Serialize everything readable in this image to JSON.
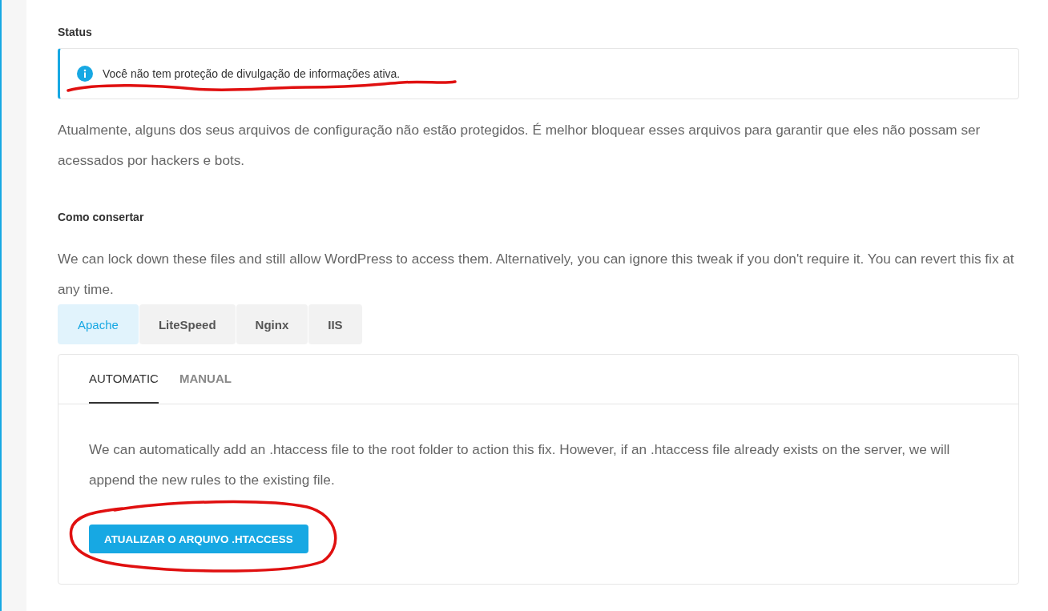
{
  "status": {
    "heading": "Status",
    "notice": "Você não tem proteção de divulgação de informações ativa.",
    "annotation": {
      "kind": "underline"
    }
  },
  "description": "Atualmente, alguns dos seus arquivos de configuração não estão protegidos. É melhor bloquear esses arquivos para garantir que eles não possam ser acessados por hackers e bots.",
  "fix": {
    "heading": "Como consertar",
    "text": "We can lock down these files and still allow WordPress to access them. Alternatively, you can ignore this tweak if you don't require it. You can revert this fix at any time."
  },
  "server_tabs": [
    {
      "label": "Apache",
      "selected": true
    },
    {
      "label": "LiteSpeed",
      "selected": false
    },
    {
      "label": "Nginx",
      "selected": false
    },
    {
      "label": "IIS",
      "selected": false
    }
  ],
  "mode_tabs": [
    {
      "label": "AUTOMATIC",
      "selected": true
    },
    {
      "label": "MANUAL",
      "selected": false
    }
  ],
  "panel": {
    "text": "We can automatically add an .htaccess file to the root folder to action this fix. However, if an .htaccess file already exists on the server, we will append the new rules to the existing file.",
    "button": "ATUALIZAR O ARQUIVO .HTACCESS",
    "annotation": {
      "kind": "circle"
    }
  }
}
